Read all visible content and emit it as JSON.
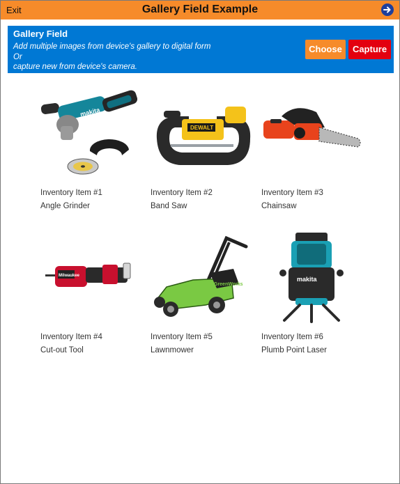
{
  "header": {
    "exit_label": "Exit",
    "title": "Gallery Field Example",
    "next_icon": "arrow-right-circle-icon"
  },
  "field": {
    "title": "Gallery Field",
    "desc_line1": "Add multiple images from device's gallery to digital form",
    "desc_line2": "Or",
    "desc_line3": "capture new from device's camera.",
    "choose_label": "Choose",
    "capture_label": "Capture",
    "colors": {
      "panel": "#0078d4",
      "choose": "#f68b2a",
      "capture": "#e3000f",
      "header": "#f68b2a"
    }
  },
  "items": [
    {
      "label": "Inventory Item #1",
      "name": "Angle Grinder"
    },
    {
      "label": "Inventory Item #2",
      "name": "Band Saw"
    },
    {
      "label": "Inventory Item #3",
      "name": "Chainsaw"
    },
    {
      "label": "Inventory Item #4",
      "name": "Cut-out Tool"
    },
    {
      "label": "Inventory Item #5",
      "name": "Lawnmower"
    },
    {
      "label": "Inventory Item #6",
      "name": "Plumb Point Laser"
    }
  ],
  "logos": {
    "grinder_brand": "makita",
    "bandsaw_brand": "DEWALT",
    "cutout_brand": "Milwaukee",
    "mower_brand": "GreenWorks",
    "laser_brand": "makita"
  }
}
